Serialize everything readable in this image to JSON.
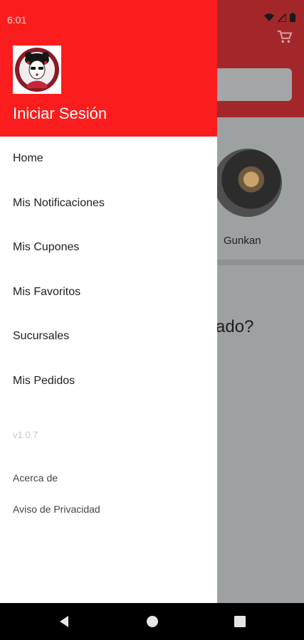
{
  "status_bar": {
    "time": "6:01"
  },
  "drawer": {
    "login_label": "Iniciar Sesión",
    "items": [
      {
        "label": "Home"
      },
      {
        "label": "Mis Notificaciones"
      },
      {
        "label": "Mis Cupones"
      },
      {
        "label": "Mis Favoritos"
      },
      {
        "label": "Sucursales"
      },
      {
        "label": "Mis Pedidos"
      }
    ],
    "version": "v1.0.7",
    "footer": [
      {
        "label": "Acerca de"
      },
      {
        "label": "Aviso de Privacidad"
      }
    ]
  },
  "background": {
    "category_label": "Gunkan",
    "question_fragment": "ado?"
  },
  "icons": {
    "cart": "cart-icon",
    "wifi": "wifi-icon",
    "signal": "signal-icon",
    "battery": "battery-icon",
    "back": "back-icon",
    "home": "home-icon",
    "recents": "recents-icon"
  },
  "colors": {
    "drawer_header": "#fb1d1d",
    "app_bar_dimmed": "#a3272a",
    "scrim": "#9ea1a2"
  }
}
